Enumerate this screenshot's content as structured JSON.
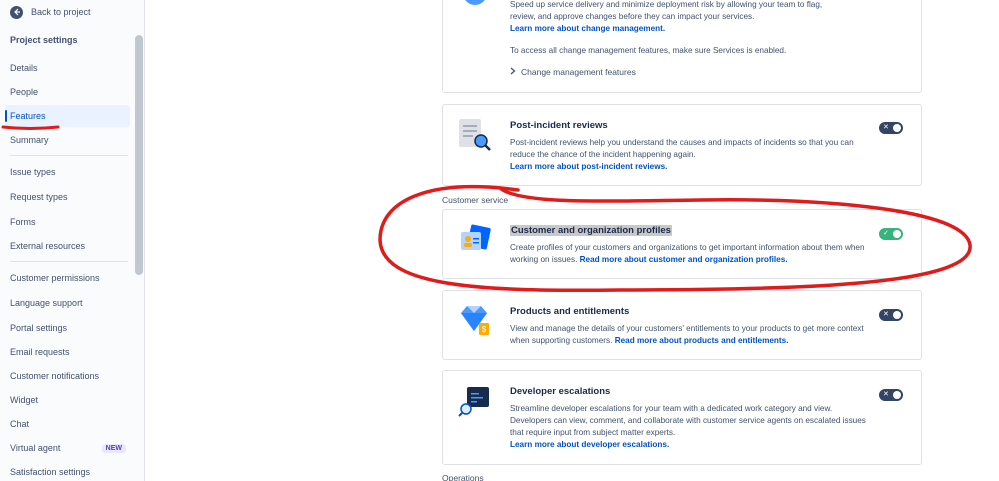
{
  "sidebar": {
    "back_label": "Back to project",
    "section_title": "Project settings",
    "items": [
      {
        "label": "Details"
      },
      {
        "label": "People"
      },
      {
        "label": "Features"
      },
      {
        "label": "Summary"
      },
      {
        "label": "Issue types"
      },
      {
        "label": "Request types"
      },
      {
        "label": "Forms"
      },
      {
        "label": "External resources"
      },
      {
        "label": "Customer permissions"
      },
      {
        "label": "Language support"
      },
      {
        "label": "Portal settings"
      },
      {
        "label": "Email requests"
      },
      {
        "label": "Customer notifications"
      },
      {
        "label": "Widget"
      },
      {
        "label": "Chat"
      },
      {
        "label": "Virtual agent",
        "badge": "NEW"
      },
      {
        "label": "Satisfaction settings"
      }
    ],
    "active_item": "Features"
  },
  "change_mgmt": {
    "desc_line1": "Speed up service delivery and minimize deployment risk by allowing your team to flag,",
    "desc_line2": "review, and approve changes before they can impact your services.",
    "link": "Learn more about change management.",
    "note": "To access all change management features, make sure Services is enabled.",
    "expand_label": "Change management features"
  },
  "post_incident": {
    "title": "Post-incident reviews",
    "desc": "Post-incident reviews help you understand the causes and impacts of incidents so that you can reduce the chance of the incident happening again.",
    "link": "Learn more about post-incident reviews.",
    "enabled": false
  },
  "group_customer_service": "Customer service",
  "customer_profiles": {
    "title": "Customer and organization profiles",
    "desc": "Create profiles of your customers and organizations to get important information about them when working on issues.",
    "link": "Read more about customer and organization profiles.",
    "enabled": true
  },
  "products": {
    "title": "Products and entitlements",
    "desc": "View and manage the details of your customers' entitlements to your products to get more context when supporting customers.",
    "link": "Read more about products and entitlements.",
    "enabled": false
  },
  "dev_escalations": {
    "title": "Developer escalations",
    "desc": "Streamline developer escalations for your team with a dedicated work category and view. Developers can view, comment, and collaborate with customer service agents on escalated issues that require input from subject matter experts.",
    "link": "Learn more about developer escalations.",
    "enabled": false
  },
  "group_operations": "Operations",
  "colors": {
    "accent": "#0052cc",
    "toggle_on": "#36b37e",
    "toggle_off": "#344563",
    "annotation": "#e01b1b"
  }
}
